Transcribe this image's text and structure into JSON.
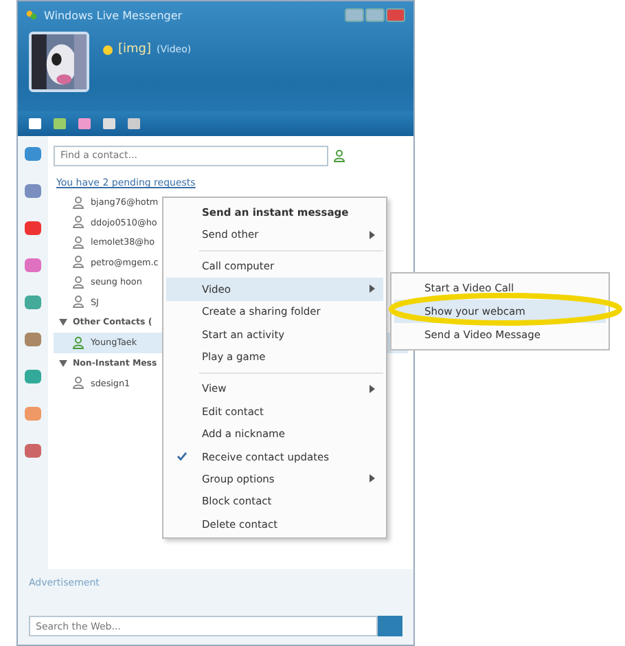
{
  "window": {
    "title": "Windows Live Messenger"
  },
  "profile": {
    "name": "[img]",
    "status": "(Video)"
  },
  "search": {
    "placeholder": "Find a contact..."
  },
  "pending_link": "You have 2 pending requests",
  "groups": [
    {
      "contacts": [
        {
          "name": "bjang76@hotm",
          "selected": false
        },
        {
          "name": "ddojo0510@ho",
          "selected": false
        },
        {
          "name": "lemolet38@ho",
          "selected": false
        },
        {
          "name": "petro@mgem.c",
          "selected": false
        },
        {
          "name": "seung hoon",
          "selected": false
        },
        {
          "name": "SJ",
          "selected": false
        }
      ]
    },
    {
      "label": "Other Contacts (",
      "expanded": true,
      "contacts": [
        {
          "name": "YoungTaek",
          "selected": true
        }
      ]
    },
    {
      "label": "Non-Instant Mess",
      "expanded": true,
      "contacts": [
        {
          "name": "sdesign1",
          "selected": false
        }
      ]
    }
  ],
  "context_menu": [
    {
      "kind": "item",
      "label": "Send an instant message",
      "bold": true,
      "submenu": false,
      "checked": false,
      "selected": false
    },
    {
      "kind": "item",
      "label": "Send other",
      "bold": false,
      "submenu": true,
      "checked": false,
      "selected": false
    },
    {
      "kind": "separator"
    },
    {
      "kind": "item",
      "label": "Call computer",
      "bold": false,
      "submenu": false,
      "checked": false,
      "selected": false
    },
    {
      "kind": "item",
      "label": "Video",
      "bold": false,
      "submenu": true,
      "checked": false,
      "selected": true
    },
    {
      "kind": "item",
      "label": "Create a sharing folder",
      "bold": false,
      "submenu": false,
      "checked": false,
      "selected": false
    },
    {
      "kind": "item",
      "label": "Start an activity",
      "bold": false,
      "submenu": false,
      "checked": false,
      "selected": false
    },
    {
      "kind": "item",
      "label": "Play a game",
      "bold": false,
      "submenu": false,
      "checked": false,
      "selected": false
    },
    {
      "kind": "separator"
    },
    {
      "kind": "item",
      "label": "View",
      "bold": false,
      "submenu": true,
      "checked": false,
      "selected": false
    },
    {
      "kind": "item",
      "label": "Edit contact",
      "bold": false,
      "submenu": false,
      "checked": false,
      "selected": false
    },
    {
      "kind": "item",
      "label": "Add a nickname",
      "bold": false,
      "submenu": false,
      "checked": false,
      "selected": false
    },
    {
      "kind": "item",
      "label": "Receive contact updates",
      "bold": false,
      "submenu": false,
      "checked": true,
      "selected": false
    },
    {
      "kind": "item",
      "label": "Group options",
      "bold": false,
      "submenu": true,
      "checked": false,
      "selected": false
    },
    {
      "kind": "item",
      "label": "Block contact",
      "bold": false,
      "submenu": false,
      "checked": false,
      "selected": false
    },
    {
      "kind": "item",
      "label": "Delete contact",
      "bold": false,
      "submenu": false,
      "checked": false,
      "selected": false
    }
  ],
  "video_submenu": [
    {
      "label": "Start a Video Call",
      "selected": false
    },
    {
      "label": "Show your webcam",
      "selected": true
    },
    {
      "label": "Send a Video Message",
      "selected": false
    }
  ],
  "annotation": {
    "kind": "ellipse",
    "color": "#f2d500"
  },
  "advertisement": "Advertisement",
  "web_search": {
    "placeholder": "Search the Web..."
  }
}
